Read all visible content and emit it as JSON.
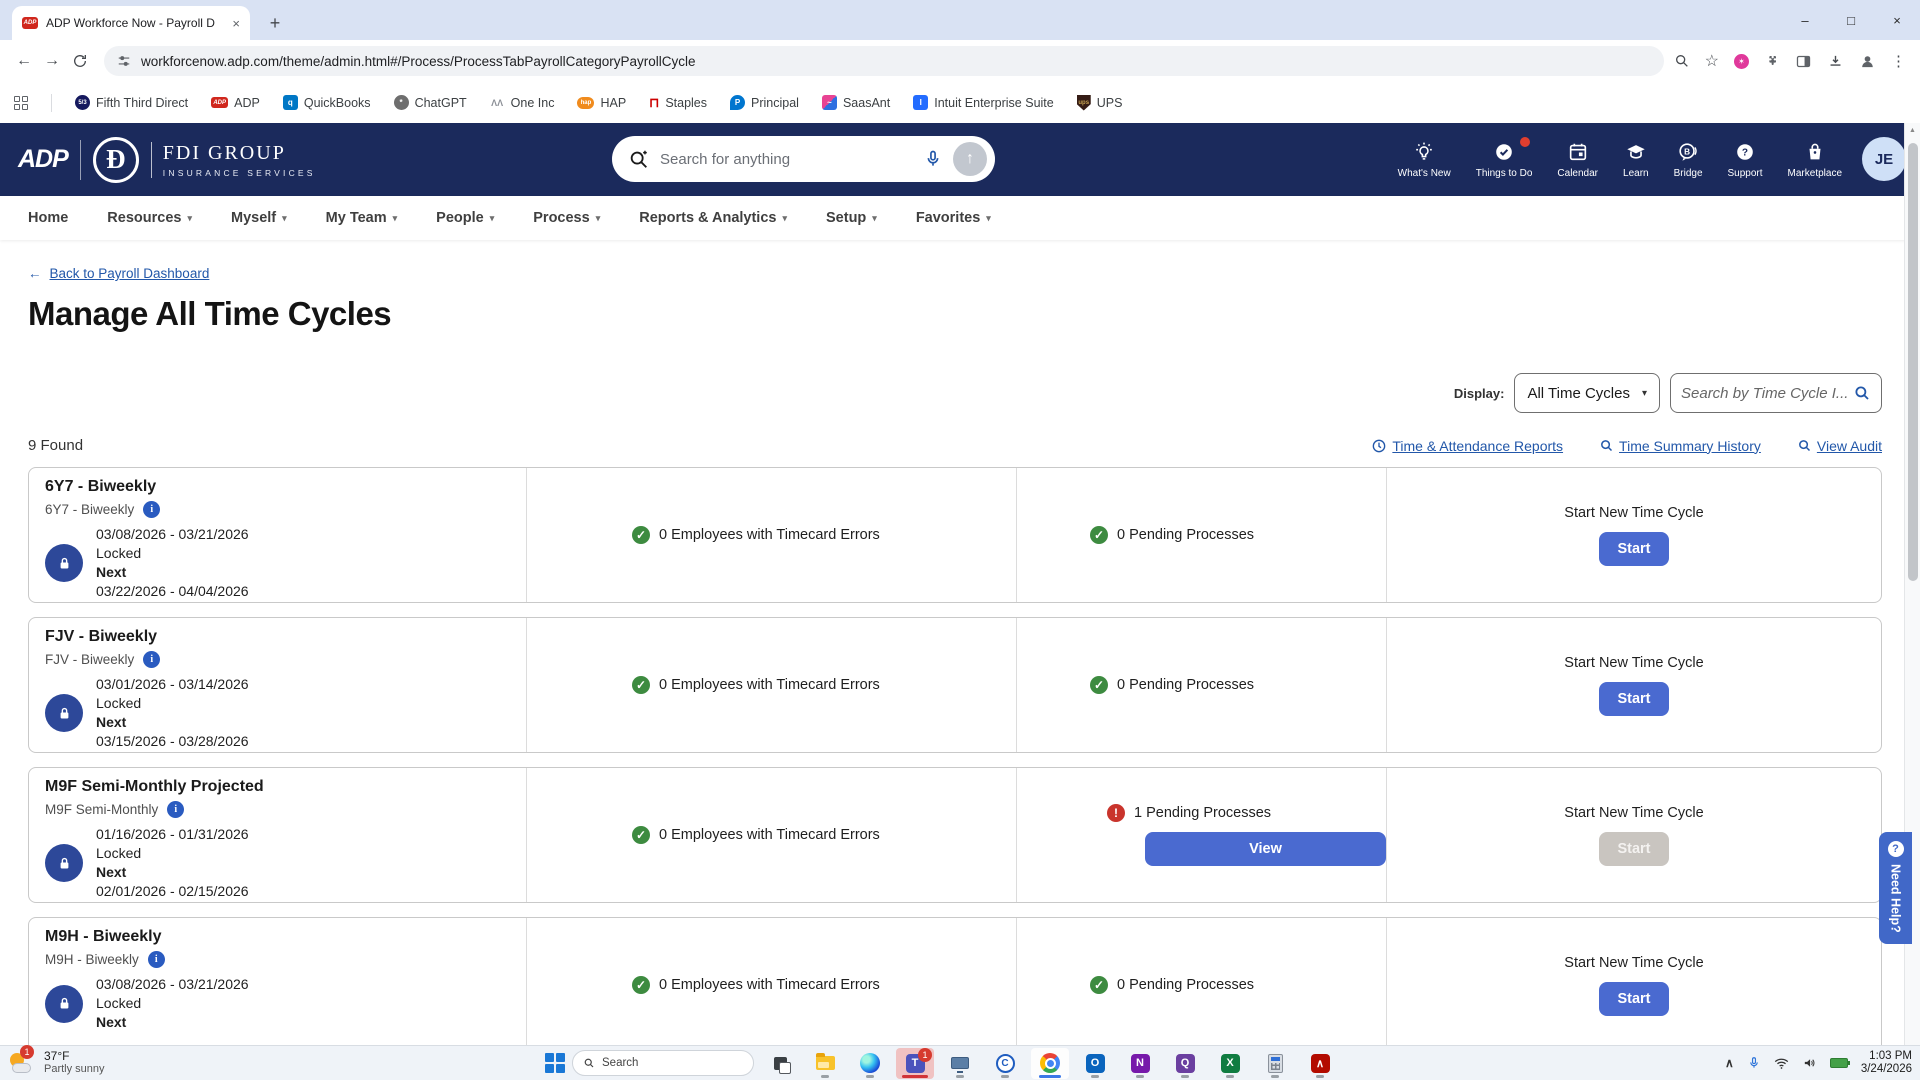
{
  "browser": {
    "tab_title": "ADP Workforce Now - Payroll D",
    "url": "workforcenow.adp.com/theme/admin.html#/Process/ProcessTabPayrollCategoryPayrollCycle",
    "bookmarks": [
      {
        "label": "Fifth Third Direct"
      },
      {
        "label": "ADP"
      },
      {
        "label": "QuickBooks"
      },
      {
        "label": "ChatGPT"
      },
      {
        "label": "One Inc"
      },
      {
        "label": "HAP"
      },
      {
        "label": "Staples"
      },
      {
        "label": "Principal"
      },
      {
        "label": "SaasAnt"
      },
      {
        "label": "Intuit Enterprise Suite"
      },
      {
        "label": "UPS"
      }
    ]
  },
  "header": {
    "brand_adp": "ADP",
    "company": "FDI GROUP",
    "company_sub": "INSURANCE SERVICES",
    "search_placeholder": "Search for anything",
    "actions": [
      {
        "label": "What's New"
      },
      {
        "label": "Things to Do"
      },
      {
        "label": "Calendar"
      },
      {
        "label": "Learn"
      },
      {
        "label": "Bridge"
      },
      {
        "label": "Support"
      },
      {
        "label": "Marketplace"
      }
    ],
    "avatar_initials": "JE"
  },
  "nav": {
    "items": [
      {
        "label": "Home"
      },
      {
        "label": "Resources"
      },
      {
        "label": "Myself"
      },
      {
        "label": "My Team"
      },
      {
        "label": "People"
      },
      {
        "label": "Process"
      },
      {
        "label": "Reports & Analytics"
      },
      {
        "label": "Setup"
      },
      {
        "label": "Favorites"
      }
    ]
  },
  "page": {
    "back_link": "Back to Payroll Dashboard",
    "title": "Manage All Time Cycles",
    "display_label": "Display:",
    "display_value": "All Time Cycles",
    "search_placeholder": "Search by Time Cycle I...",
    "found": "9 Found",
    "links": [
      {
        "label": "Time & Attendance Reports"
      },
      {
        "label": "Time Summary History"
      },
      {
        "label": "View Audit"
      }
    ],
    "need_help": "Need Help?",
    "cards": [
      {
        "title": "6Y7 - Biweekly",
        "subtitle": "6Y7 - Biweekly",
        "period": "03/08/2026 - 03/21/2026",
        "status": "Locked",
        "next_label": "Next",
        "next_period": "03/22/2026 - 04/04/2026",
        "timecard": "0 Employees with Timecard Errors",
        "pending": "0 Pending Processes",
        "start_title": "Start New Time Cycle",
        "start_label": "Start"
      },
      {
        "title": "FJV - Biweekly",
        "subtitle": "FJV - Biweekly",
        "period": "03/01/2026 - 03/14/2026",
        "status": "Locked",
        "next_label": "Next",
        "next_period": "03/15/2026 - 03/28/2026",
        "timecard": "0 Employees with Timecard Errors",
        "pending": "0 Pending Processes",
        "start_title": "Start New Time Cycle",
        "start_label": "Start"
      },
      {
        "title": "M9F Semi-Monthly Projected",
        "subtitle": "M9F Semi-Monthly",
        "period": "01/16/2026 - 01/31/2026",
        "status": "Locked",
        "next_label": "Next",
        "next_period": "02/01/2026 - 02/15/2026",
        "timecard": "0 Employees with Timecard Errors",
        "pending": "1 Pending Processes",
        "view_label": "View",
        "start_title": "Start New Time Cycle",
        "start_label": "Start"
      },
      {
        "title": "M9H - Biweekly",
        "subtitle": "M9H - Biweekly",
        "period": "03/08/2026 - 03/21/2026",
        "status": "Locked",
        "next_label": "Next",
        "next_period": "",
        "timecard": "0 Employees with Timecard Errors",
        "pending": "0 Pending Processes",
        "start_title": "Start New Time Cycle",
        "start_label": "Start"
      }
    ]
  },
  "taskbar": {
    "weather_temp": "37°F",
    "weather_desc": "Partly sunny",
    "weather_badge": "1",
    "search_placeholder": "Search",
    "teams_badge": "1",
    "time": "1:03 PM",
    "date": "3/24/2026"
  }
}
